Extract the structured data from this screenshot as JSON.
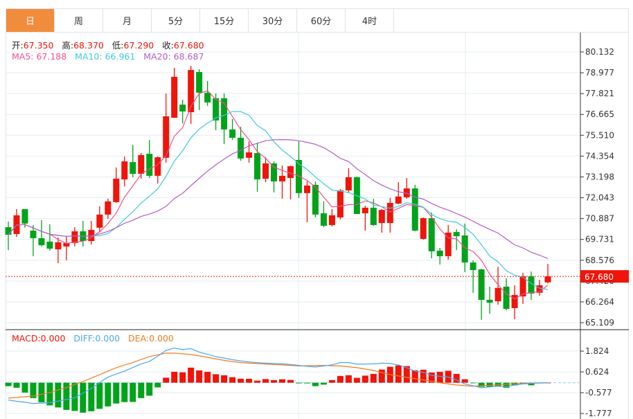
{
  "tabs": [
    {
      "label": "日",
      "active": true
    },
    {
      "label": "周"
    },
    {
      "label": "月"
    },
    {
      "label": "5分"
    },
    {
      "label": "15分"
    },
    {
      "label": "30分"
    },
    {
      "label": "60分"
    },
    {
      "label": "4时"
    }
  ],
  "ohlc_info": {
    "open_label": "开:",
    "open": "67.350",
    "high_label": "高:",
    "high": "68.370",
    "low_label": "低:",
    "low": "67.290",
    "close_label": "收:",
    "close": "67.680"
  },
  "ma_info": {
    "ma5": "MA5: 67.188",
    "ma10": "MA10: 66.961",
    "ma20": "MA20: 68.687"
  },
  "macd_info": {
    "macd": "MACD:0.000",
    "diff": "DIFF:0.000",
    "dea": "DEA:0.000"
  },
  "colors": {
    "up": "#f0140a",
    "down": "#00a31a",
    "ma5": "#f0508c",
    "ma10": "#3ec8e0",
    "ma20": "#b45ac8",
    "diff": "#4aa6f0",
    "dea": "#f57a1e",
    "accent": "#f28c3d"
  },
  "chart_data": [
    {
      "type": "candlestick",
      "title": "K-line daily",
      "ylim": [
        65.109,
        80.132
      ],
      "y_ticks": [
        "80.132",
        "78.977",
        "77.821",
        "76.665",
        "75.510",
        "74.354",
        "73.198",
        "72.043",
        "70.887",
        "69.731",
        "68.576",
        "67.420",
        "66.264",
        "65.109"
      ],
      "last_price_label": "67.680",
      "last_price": 67.68,
      "ma_periods": [
        5,
        10,
        20
      ],
      "ohlc": [
        [
          70.41,
          70.72,
          69.14,
          69.99
        ],
        [
          70.03,
          71.41,
          69.87,
          71.07
        ],
        [
          71.41,
          71.41,
          70.38,
          70.61
        ],
        [
          70.22,
          70.53,
          68.8,
          69.8
        ],
        [
          69.8,
          70.8,
          69.34,
          69.41
        ],
        [
          69.61,
          70.57,
          69.11,
          69.22
        ],
        [
          69.18,
          69.84,
          68.42,
          69.57
        ],
        [
          69.34,
          69.91,
          68.57,
          69.53
        ],
        [
          69.53,
          70.41,
          69.34,
          70.18
        ],
        [
          70.18,
          70.76,
          69.34,
          69.64
        ],
        [
          69.64,
          70.76,
          69.45,
          70.26
        ],
        [
          70.38,
          71.57,
          70.14,
          71.11
        ],
        [
          71.11,
          71.99,
          70.87,
          71.84
        ],
        [
          71.8,
          73.72,
          71.76,
          73.1
        ],
        [
          73.06,
          74.33,
          72.68,
          74.06
        ],
        [
          74.02,
          74.98,
          73.18,
          73.37
        ],
        [
          73.37,
          74.52,
          73.1,
          74.41
        ],
        [
          74.48,
          75.25,
          73.14,
          73.26
        ],
        [
          73.26,
          74.33,
          72.83,
          74.29
        ],
        [
          74.26,
          77.83,
          73.99,
          76.56
        ],
        [
          76.48,
          79.25,
          76.48,
          78.75
        ],
        [
          77.21,
          77.48,
          76.17,
          76.83
        ],
        [
          76.79,
          79.36,
          76.14,
          79.13
        ],
        [
          79.02,
          79.17,
          76.91,
          77.87
        ],
        [
          77.87,
          78.52,
          77.14,
          77.33
        ],
        [
          77.56,
          77.83,
          75.79,
          76.33
        ],
        [
          77.56,
          77.83,
          75.02,
          75.83
        ],
        [
          75.83,
          76.41,
          75.25,
          75.37
        ],
        [
          75.37,
          75.98,
          74.1,
          74.22
        ],
        [
          74.26,
          75.17,
          73.99,
          74.56
        ],
        [
          74.52,
          75.1,
          72.37,
          73.06
        ],
        [
          73.1,
          74.29,
          72.91,
          73.95
        ],
        [
          73.95,
          74.06,
          72.34,
          72.95
        ],
        [
          72.95,
          73.83,
          71.99,
          73.26
        ],
        [
          73.14,
          73.83,
          71.95,
          73.79
        ],
        [
          74.14,
          75.17,
          72.03,
          72.3
        ],
        [
          72.3,
          72.95,
          70.68,
          72.72
        ],
        [
          72.76,
          72.95,
          70.95,
          71.11
        ],
        [
          71.18,
          71.84,
          70.41,
          70.49
        ],
        [
          70.53,
          71.41,
          70.45,
          71.07
        ],
        [
          70.95,
          72.53,
          70.84,
          72.45
        ],
        [
          72.45,
          73.68,
          72.34,
          73.18
        ],
        [
          73.18,
          73.22,
          71.14,
          71.14
        ],
        [
          71.18,
          71.6,
          70.22,
          71.49
        ],
        [
          71.49,
          71.99,
          70.49,
          70.53
        ],
        [
          70.64,
          71.41,
          70.11,
          71.37
        ],
        [
          70.64,
          72.03,
          70.11,
          71.76
        ],
        [
          71.72,
          72.91,
          71.68,
          72.11
        ],
        [
          72.07,
          73.14,
          71.99,
          72.56
        ],
        [
          72.56,
          72.76,
          70.18,
          70.22
        ],
        [
          69.76,
          70.95,
          69.72,
          70.91
        ],
        [
          70.91,
          71.22,
          68.68,
          69.07
        ],
        [
          69.11,
          69.26,
          68.34,
          68.8
        ],
        [
          68.8,
          70.53,
          68.61,
          70.11
        ],
        [
          70.14,
          70.3,
          69.14,
          69.91
        ],
        [
          69.95,
          70.61,
          67.92,
          68.45
        ],
        [
          68.45,
          68.57,
          66.77,
          68.03
        ],
        [
          68.07,
          68.11,
          65.27,
          66.38
        ],
        [
          66.38,
          67.11,
          65.61,
          66.22
        ],
        [
          66.3,
          68.22,
          66.11,
          67.04
        ],
        [
          67.11,
          67.57,
          65.8,
          65.88
        ],
        [
          65.92,
          67.19,
          65.3,
          66.65
        ],
        [
          66.57,
          67.88,
          66.15,
          67.68
        ],
        [
          67.68,
          67.95,
          66.38,
          66.73
        ],
        [
          66.77,
          67.49,
          66.61,
          67.19
        ],
        [
          67.35,
          68.37,
          67.29,
          67.68
        ]
      ]
    },
    {
      "type": "bar+line",
      "title": "MACD",
      "ylim": [
        -2.2,
        2.2
      ],
      "y_ticks": [
        "1.824",
        "0.624",
        "-0.577",
        "-1.777"
      ],
      "macd": [
        -0.2,
        -0.29,
        -0.57,
        -0.89,
        -1.13,
        -1.31,
        -1.43,
        -1.57,
        -1.63,
        -1.73,
        -1.65,
        -1.51,
        -1.37,
        -1.2,
        -1.12,
        -1.11,
        -0.89,
        -0.75,
        -0.27,
        0.29,
        0.63,
        0.6,
        0.87,
        0.71,
        0.63,
        0.49,
        0.43,
        0.32,
        0.23,
        0.23,
        0.12,
        0.21,
        0.15,
        0.2,
        0.16,
        -0.04,
        -0.04,
        -0.2,
        -0.11,
        0.15,
        0.39,
        0.43,
        0.28,
        0.41,
        0.51,
        0.76,
        0.92,
        1.0,
        0.96,
        0.72,
        0.75,
        0.59,
        0.63,
        0.69,
        0.51,
        0.2,
        -0.02,
        -0.24,
        -0.24,
        -0.2,
        -0.29,
        -0.16,
        -0.08,
        -0.15,
        -0.04,
        0.0
      ],
      "diff": [
        -1.0,
        -1.07,
        -1.13,
        -1.2,
        -1.18,
        -1.15,
        -1.06,
        -0.97,
        -0.87,
        -0.6,
        -0.33,
        0.0,
        0.32,
        0.5,
        0.67,
        0.88,
        1.09,
        1.23,
        1.53,
        1.87,
        2.0,
        1.91,
        1.97,
        1.77,
        1.64,
        1.51,
        1.42,
        1.33,
        1.26,
        1.2,
        1.16,
        1.13,
        1.11,
        1.09,
        1.05,
        1.0,
        0.95,
        0.91,
        0.97,
        1.03,
        1.17,
        1.16,
        1.07,
        1.08,
        1.09,
        1.13,
        1.11,
        1.03,
        0.87,
        0.67,
        0.6,
        0.43,
        0.37,
        0.33,
        0.16,
        -0.07,
        -0.17,
        -0.29,
        -0.24,
        -0.2,
        -0.23,
        -0.13,
        -0.07,
        -0.04,
        -0.01,
        0.0
      ],
      "dea": [
        -0.89,
        -0.85,
        -0.81,
        -0.77,
        -0.67,
        -0.57,
        -0.42,
        -0.27,
        -0.1,
        0.07,
        0.27,
        0.47,
        0.67,
        0.87,
        1.02,
        1.17,
        1.34,
        1.51,
        1.61,
        1.71,
        1.71,
        1.67,
        1.63,
        1.55,
        1.47,
        1.38,
        1.29,
        1.22,
        1.16,
        1.13,
        1.11,
        1.08,
        1.05,
        1.03,
        1.0,
        0.97,
        0.98,
        0.99,
        1.0,
        0.98,
        0.97,
        0.92,
        0.87,
        0.79,
        0.71,
        0.59,
        0.47,
        0.39,
        0.31,
        0.23,
        0.16,
        0.08,
        0.0,
        -0.07,
        -0.13,
        -0.17,
        -0.2,
        -0.18,
        -0.15,
        -0.12,
        -0.09,
        -0.06,
        -0.04,
        -0.02,
        -0.01,
        0.0
      ]
    }
  ]
}
